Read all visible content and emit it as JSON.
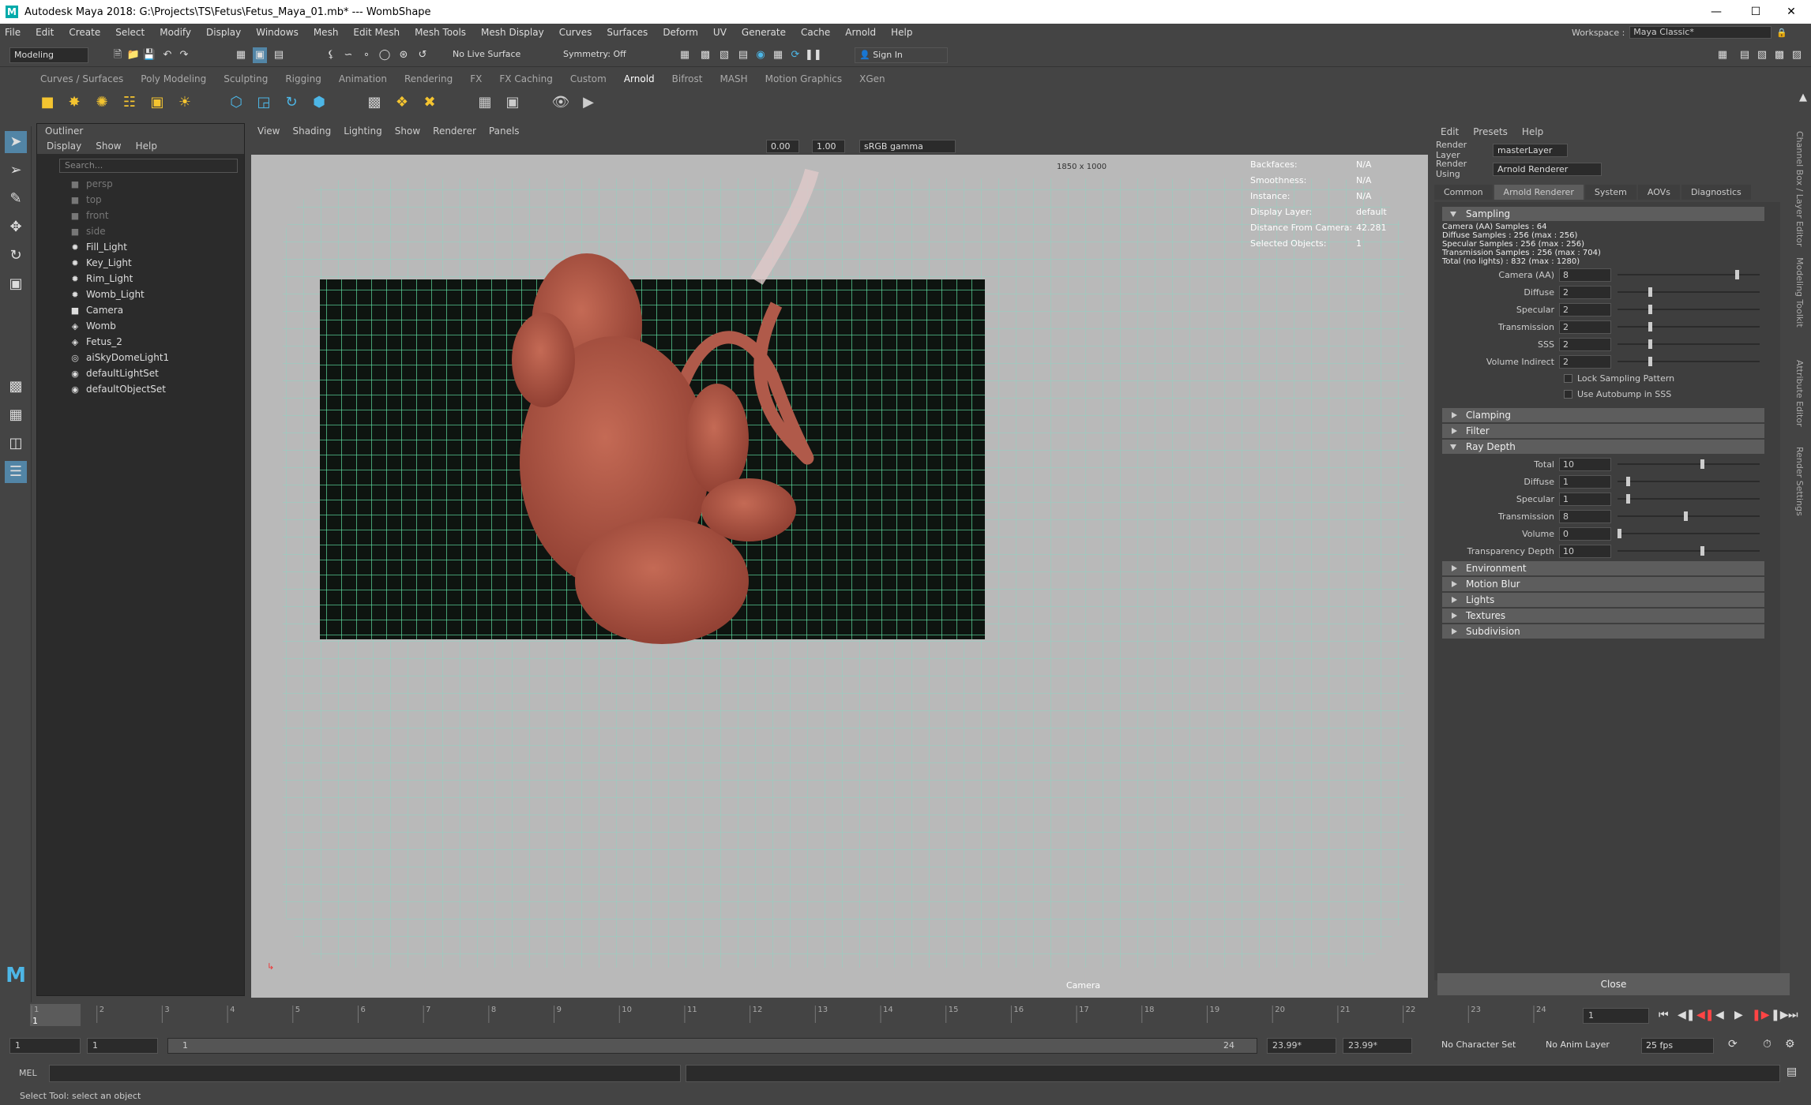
{
  "window": {
    "title": "Autodesk Maya 2018: G:\\Projects\\TS\\Fetus\\Fetus_Maya_01.mb*  ---  WombShape",
    "logo": "M",
    "controls": [
      "minimize-icon",
      "maximize-icon",
      "close-icon"
    ]
  },
  "menus": [
    "File",
    "Edit",
    "Create",
    "Select",
    "Modify",
    "Display",
    "Windows",
    "Mesh",
    "Edit Mesh",
    "Mesh Tools",
    "Mesh Display",
    "Curves",
    "Surfaces",
    "Deform",
    "UV",
    "Generate",
    "Cache",
    "Arnold",
    "Help"
  ],
  "workspace": {
    "label": "Workspace :",
    "value": "Maya Classic*"
  },
  "statusline": {
    "mode": "Modeling",
    "live_surface": "No Live Surface",
    "symmetry": "Symmetry: Off",
    "sign_in": "Sign In"
  },
  "shelf": {
    "tabs": [
      "Curves / Surfaces",
      "Poly Modeling",
      "Sculpting",
      "Rigging",
      "Animation",
      "Rendering",
      "FX",
      "FX Caching",
      "Custom",
      "Arnold",
      "Bifrost",
      "MASH",
      "Motion Graphics",
      "XGen"
    ],
    "active": "Arnold"
  },
  "outliner": {
    "title": "Outliner",
    "menu": [
      "Display",
      "Show",
      "Help"
    ],
    "search_placeholder": "Search...",
    "items": [
      {
        "name": "persp",
        "icon": "camera-icon",
        "dim": true
      },
      {
        "name": "top",
        "icon": "camera-icon",
        "dim": true
      },
      {
        "name": "front",
        "icon": "camera-icon",
        "dim": true
      },
      {
        "name": "side",
        "icon": "camera-icon",
        "dim": true
      },
      {
        "name": "Fill_Light",
        "icon": "light-icon",
        "dim": false
      },
      {
        "name": "Key_Light",
        "icon": "light-icon",
        "dim": false
      },
      {
        "name": "Rim_Light",
        "icon": "light-icon",
        "dim": false
      },
      {
        "name": "Womb_Light",
        "icon": "light-icon",
        "dim": false
      },
      {
        "name": "Camera",
        "icon": "camera-icon",
        "dim": false
      },
      {
        "name": "Womb",
        "icon": "mesh-icon",
        "dim": false
      },
      {
        "name": "Fetus_2",
        "icon": "mesh-icon",
        "dim": false
      },
      {
        "name": "aiSkyDomeLight1",
        "icon": "skydome-icon",
        "dim": false
      },
      {
        "name": "defaultLightSet",
        "icon": "set-icon",
        "dim": false
      },
      {
        "name": "defaultObjectSet",
        "icon": "set-icon",
        "dim": false
      }
    ]
  },
  "viewport": {
    "menu": [
      "View",
      "Shading",
      "Lighting",
      "Show",
      "Renderer",
      "Panels"
    ],
    "near": "0.00",
    "far": "1.00",
    "color_space": "sRGB gamma",
    "resolution": "1850 x 1000",
    "camera_label": "Camera",
    "hud": [
      [
        "Backfaces:",
        "N/A"
      ],
      [
        "Smoothness:",
        "N/A"
      ],
      [
        "Instance:",
        "N/A"
      ],
      [
        "Display Layer:",
        "default"
      ],
      [
        "Distance From Camera:",
        "42.281"
      ],
      [
        "Selected Objects:",
        "1"
      ]
    ]
  },
  "render_settings": {
    "menu": [
      "Edit",
      "Presets",
      "Help"
    ],
    "render_layer_label": "Render Layer",
    "render_layer": "masterLayer",
    "render_using_label": "Render Using",
    "render_using": "Arnold Renderer",
    "tabs": [
      "Common",
      "Arnold Renderer",
      "System",
      "AOVs",
      "Diagnostics"
    ],
    "active_tab": "Arnold Renderer",
    "sampling_title": "Sampling",
    "sampling_info": [
      "Camera (AA) Samples : 64",
      "Diffuse Samples : 256 (max : 256)",
      "Specular Samples : 256 (max : 256)",
      "Transmission Samples : 256 (max : 704)",
      "Total (no lights) : 832 (max : 1280)"
    ],
    "sampling": [
      {
        "label": "Camera (AA)",
        "value": "8",
        "pos": 0.85
      },
      {
        "label": "Diffuse",
        "value": "2",
        "pos": 0.22
      },
      {
        "label": "Specular",
        "value": "2",
        "pos": 0.22
      },
      {
        "label": "Transmission",
        "value": "2",
        "pos": 0.22
      },
      {
        "label": "SSS",
        "value": "2",
        "pos": 0.22
      },
      {
        "label": "Volume Indirect",
        "value": "2",
        "pos": 0.22
      }
    ],
    "checkboxes": [
      "Lock Sampling Pattern",
      "Use Autobump in SSS"
    ],
    "collapsed_a": [
      "Clamping",
      "Filter"
    ],
    "ray_depth_title": "Ray Depth",
    "ray_depth": [
      {
        "label": "Total",
        "value": "10",
        "pos": 0.6
      },
      {
        "label": "Diffuse",
        "value": "1",
        "pos": 0.06
      },
      {
        "label": "Specular",
        "value": "1",
        "pos": 0.06
      },
      {
        "label": "Transmission",
        "value": "8",
        "pos": 0.48
      },
      {
        "label": "Volume",
        "value": "0",
        "pos": 0.0
      },
      {
        "label": "Transparency Depth",
        "value": "10",
        "pos": 0.6
      }
    ],
    "collapsed_b": [
      "Environment",
      "Motion Blur",
      "Lights",
      "Textures",
      "Subdivision"
    ],
    "close": "Close"
  },
  "side_tabs": [
    "Channel Box / Layer Editor",
    "Modeling Toolkit",
    "Attribute Editor",
    "Render Settings"
  ],
  "timeline": {
    "ticks": [
      "1",
      "2",
      "3",
      "4",
      "5",
      "6",
      "7",
      "8",
      "9",
      "10",
      "11",
      "12",
      "13",
      "14",
      "15",
      "16",
      "17",
      "18",
      "19",
      "20",
      "21",
      "22",
      "23",
      "24"
    ],
    "current": "1",
    "field": "1"
  },
  "range": {
    "start": "1",
    "play_start": "1",
    "slider_start": "1",
    "slider_end": "24",
    "end1": "23.99*",
    "end2": "23.99*",
    "character_set": "No Character Set",
    "anim_layer": "No Anim Layer",
    "fps": "25 fps"
  },
  "cmdline": {
    "lang": "MEL"
  },
  "helpline": "Select Tool: select an object"
}
